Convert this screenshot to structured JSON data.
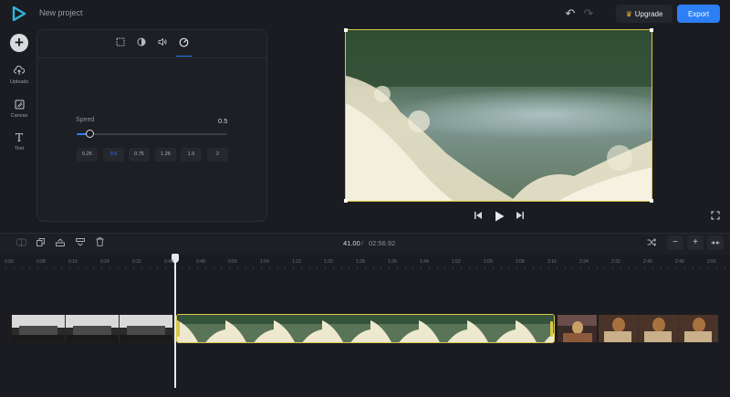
{
  "app": {
    "project_title": "New project",
    "upgrade_label": "Upgrade",
    "export_label": "Export",
    "accent_color": "#2c7ff4",
    "selection_color": "#d8c84a"
  },
  "rail": {
    "items": [
      {
        "label": "Uploads",
        "icon": "upload-cloud-icon"
      },
      {
        "label": "Canvas",
        "icon": "canvas-icon"
      },
      {
        "label": "Text",
        "icon": "text-icon"
      }
    ]
  },
  "panel": {
    "tabs": [
      "crop-icon",
      "adjust-contrast-icon",
      "volume-icon",
      "speed-icon"
    ],
    "active_tab": "speed-icon",
    "speed_label": "Speed",
    "speed_value": "0.5",
    "slider_fraction": 0.09,
    "presets": [
      "0.25",
      "0.5",
      "0.75",
      "1.25",
      "1.5",
      "2"
    ],
    "active_preset": "0.5"
  },
  "timeline": {
    "current_time": "41.00",
    "separator": "/",
    "total_time": "02:56.92",
    "ruler_labels": [
      "0:00",
      "0:08",
      "0:16",
      "0:24",
      "0:32",
      "0:40",
      "0:48",
      "0:56",
      "1:04",
      "1:12",
      "1:20",
      "1:28",
      "1:36",
      "1:44",
      "1:52",
      "2:00",
      "2:08",
      "2:16",
      "2:24",
      "2:32",
      "2:40",
      "2:48",
      "2:56"
    ]
  }
}
